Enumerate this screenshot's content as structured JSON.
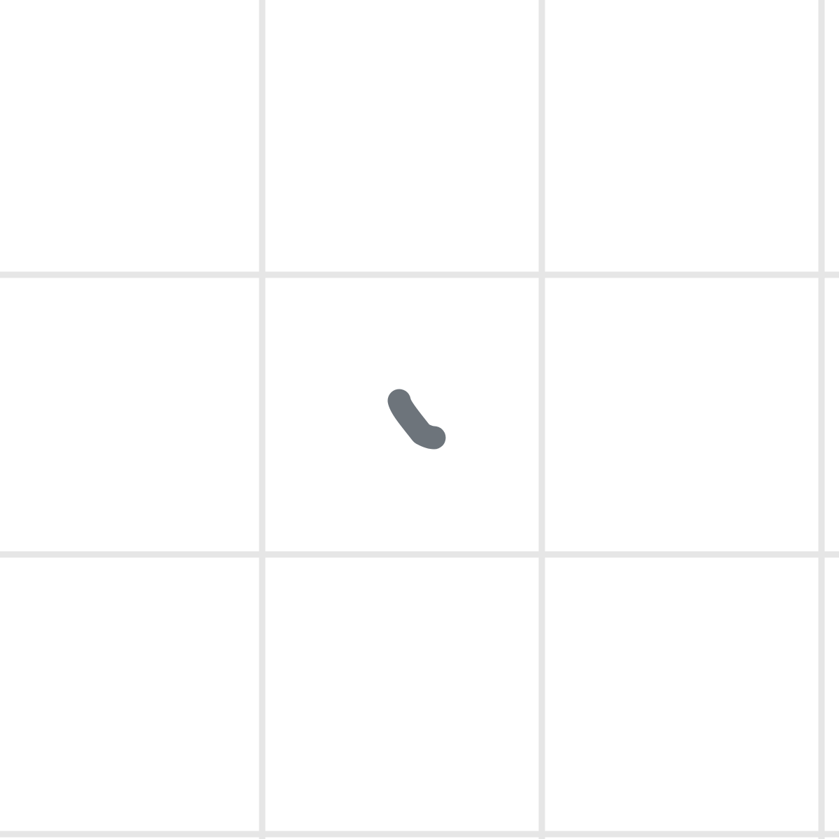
{
  "colors": {
    "background": "#ffffff",
    "grid_line": "#e6e6e6",
    "stroke": "#6d747b"
  },
  "canvas": {
    "grid": {
      "columns": 3,
      "rows": 3,
      "visible": true
    },
    "strokes": [
      {
        "name": "freehand-stroke",
        "tool": "pen"
      }
    ]
  }
}
